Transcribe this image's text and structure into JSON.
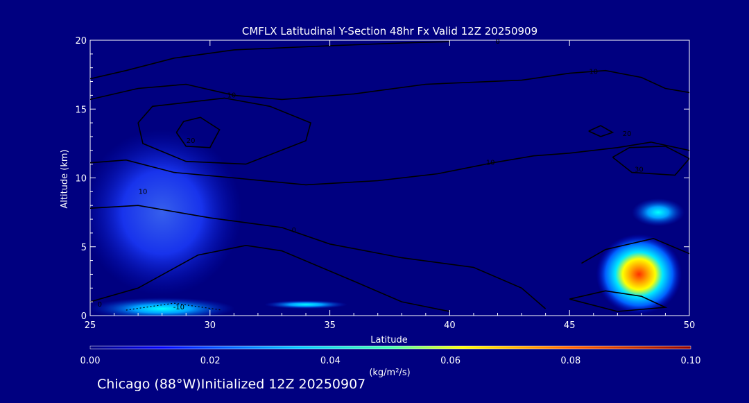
{
  "chart_data": {
    "type": "heatmap",
    "title": "CMFLX Latitudinal Y-Section 48hr  Fx Valid 12Z 20250909",
    "xlabel": "Latitude",
    "ylabel": "Altitude (km)",
    "xlim": [
      25,
      50
    ],
    "ylim": [
      0,
      20
    ],
    "x_ticks": [
      "25",
      "30",
      "35",
      "40",
      "45",
      "50"
    ],
    "y_ticks": [
      "0",
      "5",
      "10",
      "15",
      "20"
    ],
    "colorbar": {
      "label": "(kg/m²/s)",
      "range": [
        0.0,
        0.1
      ],
      "ticks": [
        "0.00",
        "0.02",
        "0.04",
        "0.06",
        "0.08",
        "0.10"
      ]
    },
    "filled_regions": [
      {
        "lat": 28.0,
        "alt": 7.5,
        "value": 0.012
      },
      {
        "lat": 28.0,
        "alt": 0.5,
        "value": 0.022
      },
      {
        "lat": 34.0,
        "alt": 0.8,
        "value": 0.02
      },
      {
        "lat": 47.9,
        "alt": 3.0,
        "value": 0.07
      },
      {
        "lat": 48.7,
        "alt": 7.5,
        "value": 0.035
      }
    ],
    "contour_labels": [
      {
        "text": "0",
        "lat": 33.5,
        "alt": 6.2
      },
      {
        "text": "0",
        "lat": 25.4,
        "alt": 0.8
      },
      {
        "text": "0",
        "lat": 42.0,
        "alt": 19.9
      },
      {
        "text": "10",
        "lat": 27.2,
        "alt": 9.0
      },
      {
        "text": "10",
        "lat": 30.9,
        "alt": 16.0
      },
      {
        "text": "10",
        "lat": 41.7,
        "alt": 11.1
      },
      {
        "text": "10",
        "lat": 46.0,
        "alt": 17.7
      },
      {
        "text": "20",
        "lat": 29.2,
        "alt": 12.7
      },
      {
        "text": "20",
        "lat": 47.4,
        "alt": 13.2
      },
      {
        "text": "30",
        "lat": 47.9,
        "alt": 10.6
      },
      {
        "text": "-10",
        "lat": 28.7,
        "alt": 0.6
      }
    ],
    "contours": [
      {
        "level": 10,
        "points": [
          [
            25,
            17.2
          ],
          [
            26.5,
            17.8
          ],
          [
            28.5,
            18.7
          ],
          [
            31,
            19.3
          ],
          [
            35,
            19.6
          ],
          [
            38,
            19.8
          ],
          [
            40,
            19.9
          ]
        ]
      },
      {
        "level": 10,
        "points": [
          [
            25,
            15.7
          ],
          [
            27,
            16.5
          ],
          [
            29,
            16.8
          ],
          [
            31,
            16.0
          ],
          [
            33,
            15.7
          ],
          [
            36,
            16.1
          ],
          [
            39,
            16.8
          ],
          [
            43,
            17.1
          ],
          [
            45,
            17.6
          ],
          [
            46.5,
            17.8
          ],
          [
            48,
            17.3
          ],
          [
            49,
            16.5
          ],
          [
            50,
            16.2
          ]
        ]
      },
      {
        "level": 20,
        "points": [
          [
            27,
            14.0
          ],
          [
            27.6,
            15.2
          ],
          [
            30.6,
            15.8
          ],
          [
            32.5,
            15.2
          ],
          [
            34.2,
            14.0
          ],
          [
            34.0,
            12.7
          ],
          [
            31.5,
            11.0
          ],
          [
            29.0,
            11.2
          ],
          [
            27.2,
            12.5
          ],
          [
            27,
            14.0
          ]
        ]
      },
      {
        "level": 20,
        "points": [
          [
            28.6,
            13.3
          ],
          [
            28.9,
            14.1
          ],
          [
            29.6,
            14.4
          ],
          [
            30.4,
            13.5
          ],
          [
            30.0,
            12.2
          ],
          [
            29.0,
            12.3
          ],
          [
            28.6,
            13.3
          ]
        ]
      },
      {
        "level": 10,
        "points": [
          [
            25,
            11.1
          ],
          [
            26.5,
            11.3
          ],
          [
            28.5,
            10.4
          ],
          [
            31,
            10.0
          ],
          [
            34,
            9.5
          ],
          [
            37,
            9.8
          ],
          [
            39.5,
            10.3
          ],
          [
            41.8,
            11.1
          ],
          [
            43.5,
            11.6
          ],
          [
            45,
            11.8
          ],
          [
            47,
            12.2
          ],
          [
            48.4,
            12.6
          ],
          [
            50,
            12.0
          ]
        ]
      },
      {
        "level": 30,
        "points": [
          [
            45.8,
            13.4
          ],
          [
            46.3,
            13.8
          ],
          [
            46.8,
            13.3
          ],
          [
            46.3,
            13.0
          ],
          [
            45.8,
            13.4
          ]
        ]
      },
      {
        "level": 30,
        "points": [
          [
            46.8,
            11.5
          ],
          [
            47.5,
            12.2
          ],
          [
            49.0,
            12.3
          ],
          [
            50.0,
            11.4
          ],
          [
            49.4,
            10.2
          ],
          [
            47.6,
            10.4
          ],
          [
            46.8,
            11.5
          ]
        ]
      },
      {
        "level": 0,
        "points": [
          [
            25,
            7.8
          ],
          [
            27,
            8.0
          ],
          [
            30,
            7.1
          ],
          [
            33,
            6.4
          ],
          [
            35,
            5.2
          ],
          [
            38,
            4.2
          ],
          [
            41,
            3.5
          ],
          [
            43,
            2.0
          ],
          [
            44,
            0.5
          ]
        ]
      },
      {
        "level": 0,
        "points": [
          [
            25,
            1.0
          ],
          [
            27,
            2.0
          ],
          [
            29.5,
            4.4
          ],
          [
            31.5,
            5.1
          ],
          [
            33,
            4.7
          ],
          [
            34.5,
            3.6
          ],
          [
            36,
            2.5
          ],
          [
            38,
            1.0
          ],
          [
            40,
            0.3
          ]
        ]
      },
      {
        "level": 0,
        "points": [
          [
            45.0,
            1.2
          ],
          [
            46.5,
            1.8
          ],
          [
            48.0,
            1.4
          ],
          [
            49.0,
            0.6
          ],
          [
            47.0,
            0.3
          ],
          [
            45.0,
            1.2
          ]
        ]
      },
      {
        "level": 0,
        "points": [
          [
            45.5,
            3.8
          ],
          [
            46.5,
            4.8
          ],
          [
            48.5,
            5.6
          ],
          [
            50.0,
            4.5
          ]
        ]
      }
    ]
  },
  "footer": {
    "location": "Chicago (88°W)",
    "initialized": "Initialized 12Z 20250907"
  }
}
